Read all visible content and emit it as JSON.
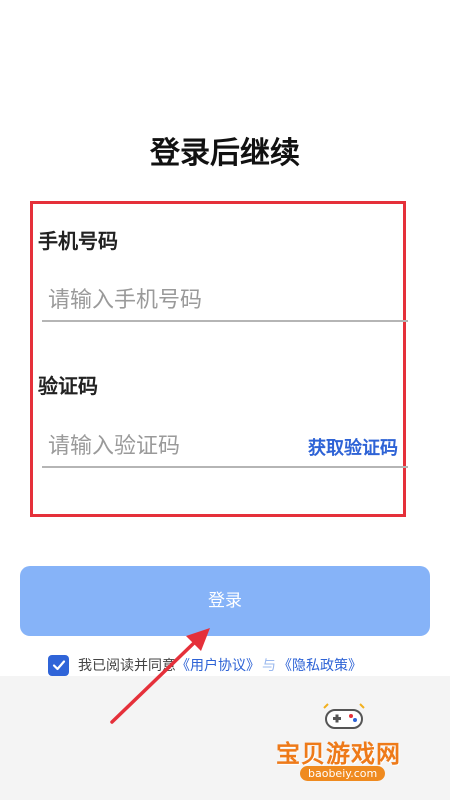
{
  "header": {
    "title": "登录后继续"
  },
  "form": {
    "phone": {
      "label": "手机号码",
      "placeholder": "请输入手机号码",
      "value": ""
    },
    "code": {
      "label": "验证码",
      "placeholder": "请输入验证码",
      "value": "",
      "get_code_label": "获取验证码"
    }
  },
  "login_button": {
    "label": "登录"
  },
  "agreement": {
    "checked": true,
    "prefix": "我已阅读并同意",
    "user_agreement": "《用户协议》",
    "and": "与",
    "privacy_policy": "《隐私政策》"
  },
  "watermark": {
    "name": "宝贝游戏网",
    "url": "baobeiy.com"
  },
  "colors": {
    "highlight": "#e5303a",
    "accent": "#2e63d6",
    "button": "#86b3f8",
    "watermark": "#ee7a19",
    "arrow": "#e5303a"
  }
}
